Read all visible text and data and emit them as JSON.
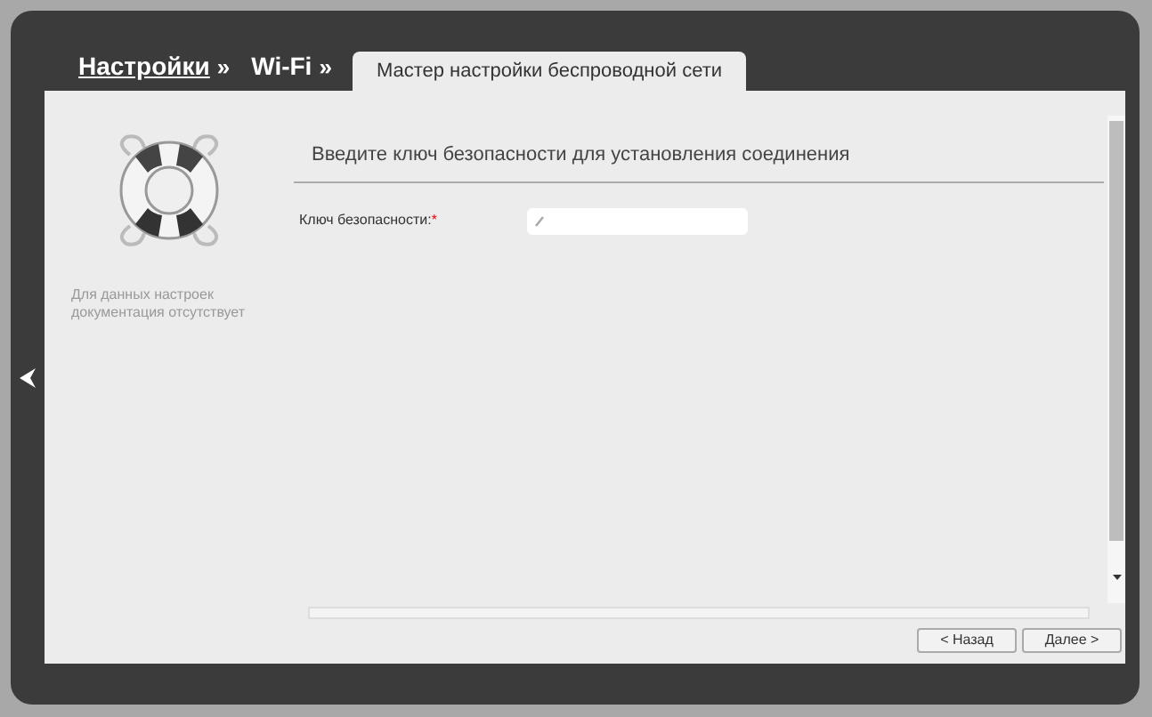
{
  "breadcrumbs": [
    {
      "label": "Настройки",
      "separator": "»"
    },
    {
      "label": "Wi-Fi",
      "separator": "»"
    }
  ],
  "tabs": [
    {
      "label": "Мастер настройки беспроводной сети",
      "selected": true
    }
  ],
  "help_text": "Для данных настроек документация отсутствует",
  "section_title": "Введите ключ безопасности для установления соединения",
  "fields": [
    {
      "label": "Ключ безопасности:",
      "required_mark": "*"
    }
  ],
  "buttons": [
    "< Назад",
    "Далее >"
  ]
}
